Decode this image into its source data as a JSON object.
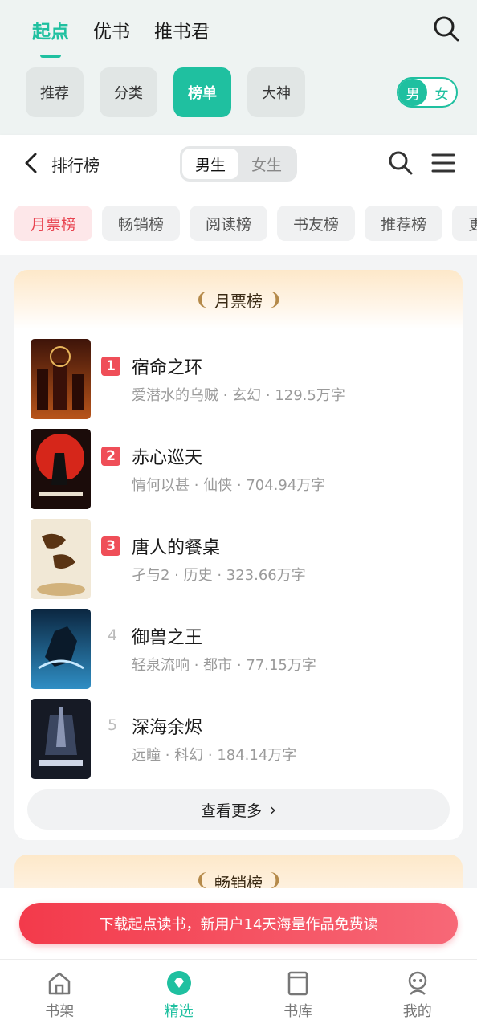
{
  "header": {
    "tabs": [
      "起点",
      "优书",
      "推书君"
    ],
    "active_tab": 0,
    "chips": [
      "推荐",
      "分类",
      "榜单",
      "大神"
    ],
    "active_chip": 2,
    "gender": {
      "male": "男",
      "female": "女",
      "selected": "男"
    }
  },
  "rank_bar": {
    "title": "排行榜",
    "segments": [
      "男生",
      "女生"
    ],
    "selected": "男生"
  },
  "filters": [
    "月票榜",
    "畅销榜",
    "阅读榜",
    "书友榜",
    "推荐榜",
    "更"
  ],
  "card": {
    "title": "月票榜",
    "books": [
      {
        "rank": "1",
        "title": "宿命之环",
        "meta": "爱潜水的乌贼 · 玄幻 · 129.5万字",
        "cover_colors": [
          "#5b1e10",
          "#c05a1c"
        ]
      },
      {
        "rank": "2",
        "title": "赤心巡天",
        "meta": "情何以甚 · 仙侠 · 704.94万字",
        "cover_colors": [
          "#c81f14",
          "#f15a24"
        ]
      },
      {
        "rank": "3",
        "title": "唐人的餐桌",
        "meta": "孑与2 · 历史 · 323.66万字",
        "cover_colors": [
          "#efe6d4",
          "#d7bf94"
        ]
      },
      {
        "rank": "4",
        "title": "御兽之王",
        "meta": "轻泉流响 · 都市 · 77.15万字",
        "cover_colors": [
          "#0e2d4a",
          "#3ea6d6"
        ]
      },
      {
        "rank": "5",
        "title": "深海余烬",
        "meta": "远瞳 · 科幻 · 184.14万字",
        "cover_colors": [
          "#1a1f2c",
          "#4b5874"
        ]
      }
    ],
    "more_label": "查看更多"
  },
  "card2": {
    "title": "畅销榜"
  },
  "banner": {
    "text": "下载起点读书，新用户14天海量作品免费读"
  },
  "bottom_nav": {
    "items": [
      "书架",
      "精选",
      "书库",
      "我的"
    ],
    "active": 1
  },
  "colors": {
    "accent": "#1fc0a0",
    "rank_red": "#ef4e58",
    "banner": "#f33a4b"
  }
}
